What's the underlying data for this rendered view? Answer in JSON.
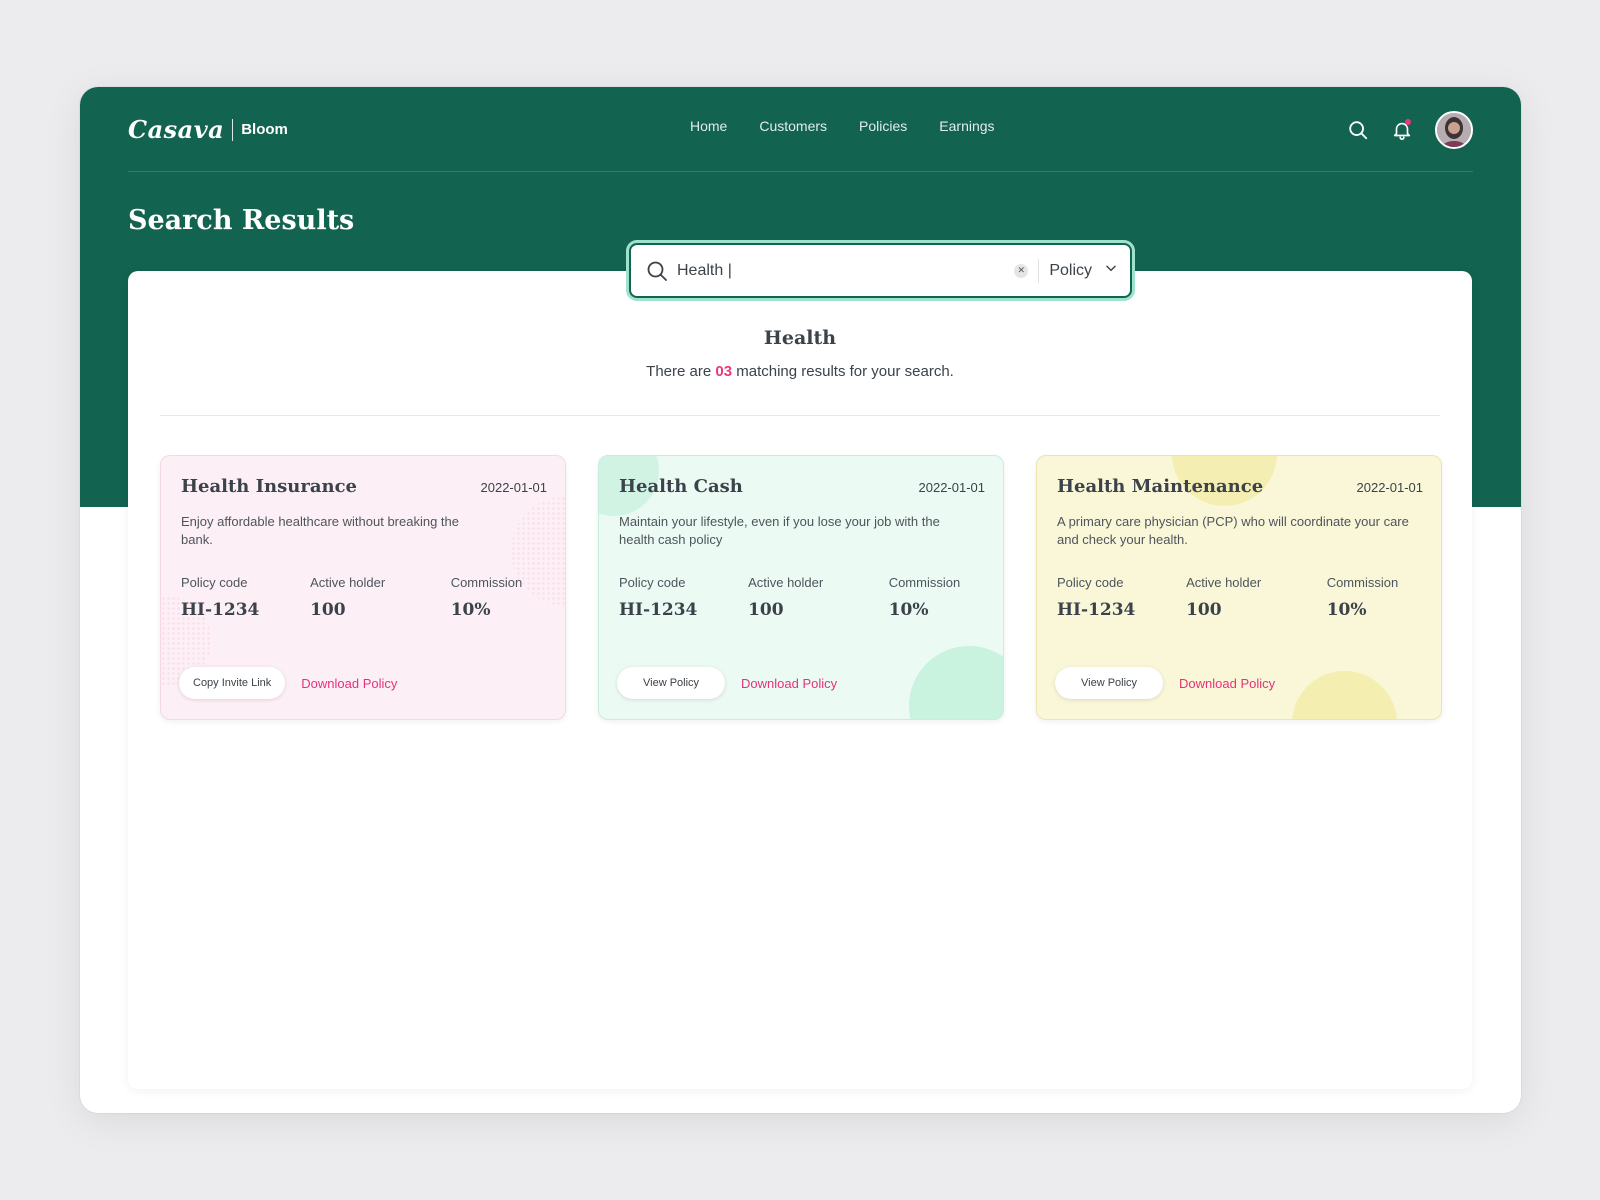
{
  "header": {
    "logo_main": "Casava",
    "logo_sub": "Bloom",
    "nav": [
      "Home",
      "Customers",
      "Policies",
      "Earnings"
    ]
  },
  "page": {
    "title": "Search Results"
  },
  "search": {
    "value": "Health |",
    "filter_selected": "Policy"
  },
  "results": {
    "title": "Health",
    "text_before": "There are",
    "count": "03",
    "text_after": "matching results for your search."
  },
  "cards": [
    {
      "title": "Health Insurance",
      "date": "2022-01-01",
      "description": "Enjoy affordable healthcare without breaking the bank.",
      "policy_code_label": "Policy code",
      "policy_code": "HI-1234",
      "active_holder_label": "Active holder",
      "active_holder": "100",
      "commission_label": "Commission",
      "commission": "10%",
      "primary_action": "Copy Invite Link",
      "secondary_action": "Download Policy"
    },
    {
      "title": "Health Cash",
      "date": "2022-01-01",
      "description": "Maintain your lifestyle, even if you lose your job with the health cash policy",
      "policy_code_label": "Policy code",
      "policy_code": "HI-1234",
      "active_holder_label": "Active holder",
      "active_holder": "100",
      "commission_label": "Commission",
      "commission": "10%",
      "primary_action": "View Policy",
      "secondary_action": "Download Policy"
    },
    {
      "title": "Health Maintenance",
      "date": "2022-01-01",
      "description": "A primary care physician (PCP) who will coordinate your care and check your health.",
      "policy_code_label": "Policy code",
      "policy_code": "HI-1234",
      "active_holder_label": "Active holder",
      "active_holder": "100",
      "commission_label": "Commission",
      "commission": "10%",
      "primary_action": "View Policy",
      "secondary_action": "Download Policy"
    }
  ],
  "colors": {
    "brand_green": "#136351",
    "accent_pink": "#f0357b",
    "card_pink": "#fcf0f6",
    "card_green": "#ebfaf3",
    "card_yellow": "#f9f7d8"
  },
  "icons": {
    "search": "search-icon",
    "notifications": "bell-icon",
    "clear": "close-icon",
    "dropdown": "chevron-down-icon"
  }
}
